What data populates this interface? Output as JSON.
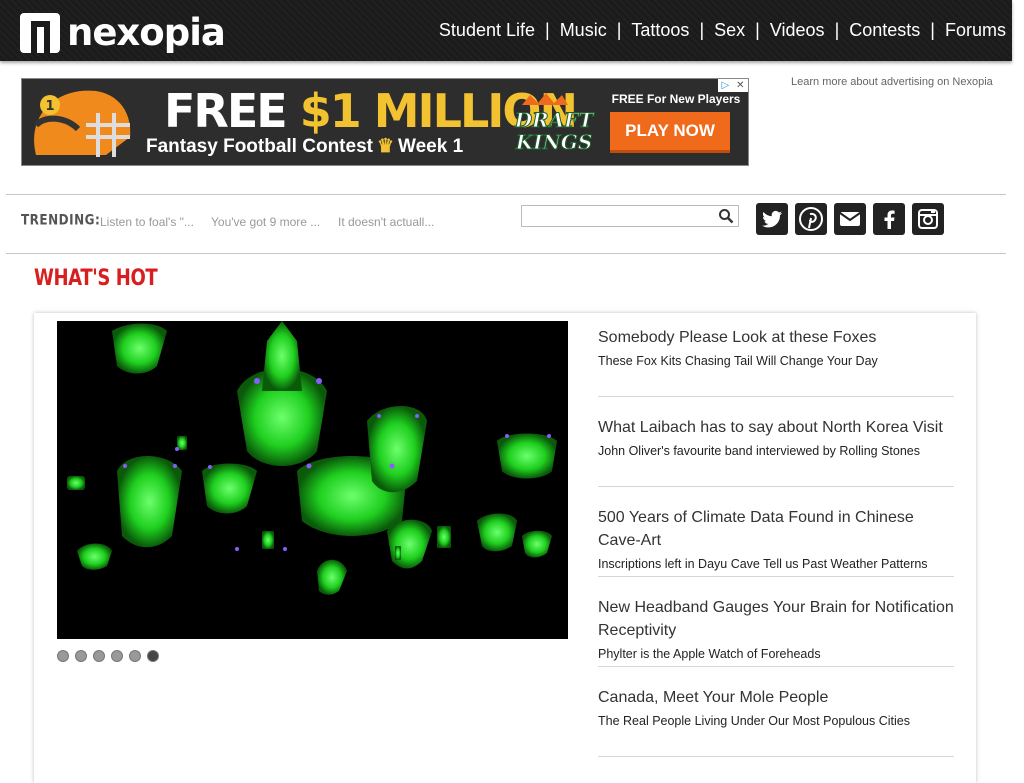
{
  "header": {
    "logo_text": "nexopia",
    "nav": [
      "Student Life",
      "Music",
      "Tattoos",
      "Sex",
      "Videos",
      "Contests",
      "Forums"
    ]
  },
  "ad": {
    "headline_white": "FREE ",
    "headline_gold": "$1 MILLION",
    "subline_left": "Fantasy Football Contest",
    "subline_right": "Week 1",
    "free_text": "FREE For New Players",
    "cta": "PLAY NOW",
    "brand_top": "DRAFT",
    "brand_bottom": "KINGS",
    "learn_more": "Learn more about advertising on Nexopia",
    "colors": {
      "gold": "#f2c230",
      "cta": "#f06a1c",
      "ad_bg": "#2d2d2d"
    }
  },
  "trending": {
    "label": "TRENDING:",
    "items": [
      "Listen to foal's \"...",
      "You've got 9 more ...",
      "It doesn't actuall..."
    ],
    "search_placeholder": ""
  },
  "social_icons": [
    "twitter-icon",
    "pinterest-icon",
    "email-icon",
    "facebook-icon",
    "instagram-icon"
  ],
  "whats_hot": {
    "heading": "WHAT'S HOT",
    "slider_dots": 6,
    "active_dot": 6,
    "stories": [
      {
        "title": "Somebody Please Look at these Foxes",
        "subtitle": "These Fox Kits Chasing Tail Will Change Your Day"
      },
      {
        "title": "What Laibach has to say about North Korea Visit",
        "subtitle": "John Oliver's favourite band interviewed by Rolling Stones"
      },
      {
        "title": "500 Years of Climate Data Found in Chinese Cave-Art",
        "subtitle": "Inscriptions left in Dayu Cave Tell us Past Weather Patterns"
      },
      {
        "title": "New Headband Gauges Your Brain for Notification Receptivity",
        "subtitle": "Phylter is the Apple Watch of Foreheads"
      },
      {
        "title": "Canada, Meet Your Mole People",
        "subtitle": "The Real People Living Under Our Most Populous Cities"
      }
    ],
    "colors": {
      "heading": "#d81e1e",
      "chandelier": "#2dd62d"
    }
  }
}
